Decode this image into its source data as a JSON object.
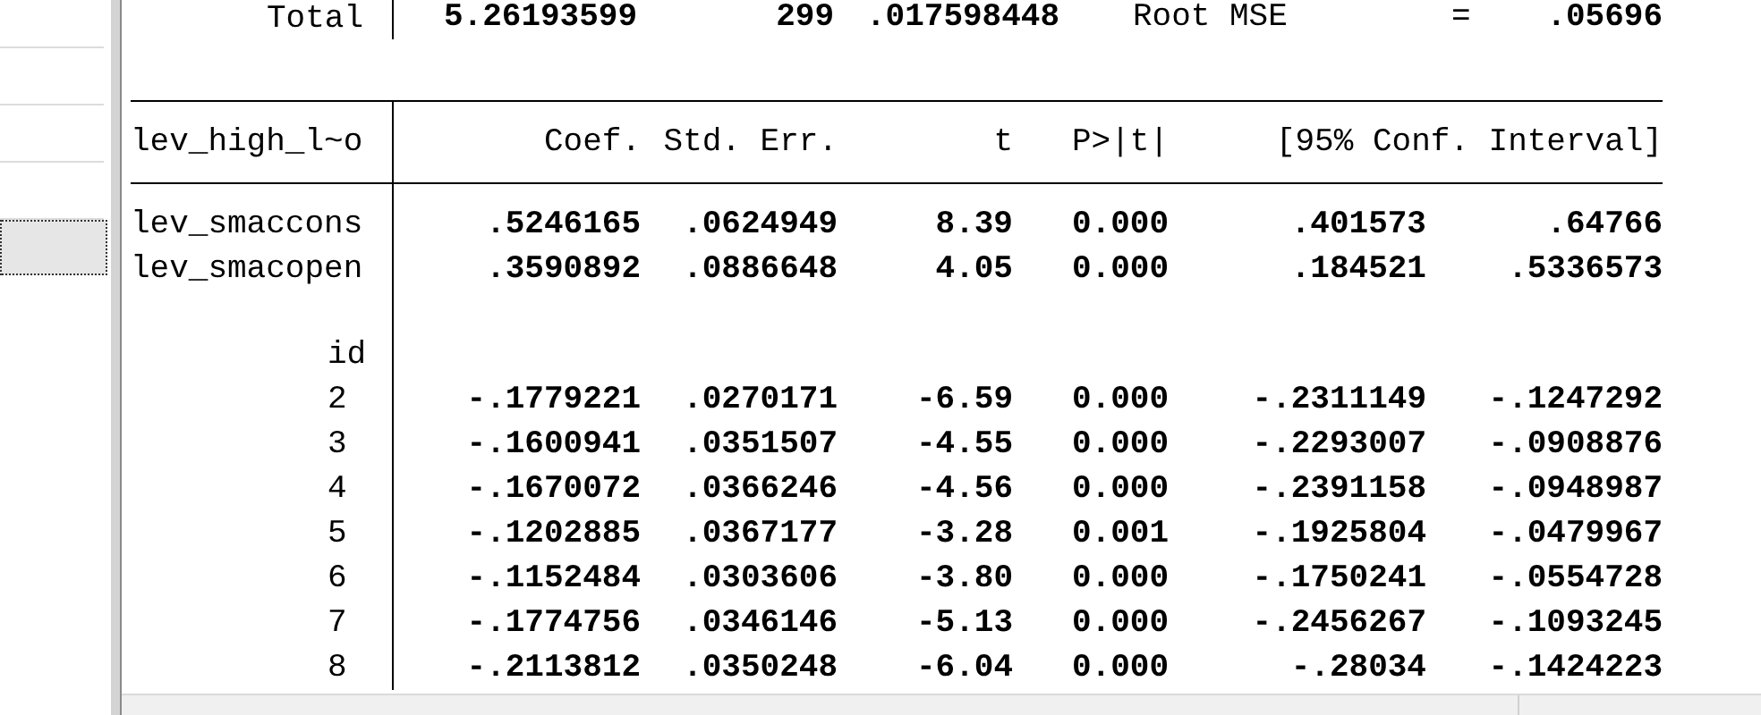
{
  "sidebar": {
    "items": [
      {
        "selected": false
      },
      {
        "selected": false
      },
      {
        "selected": false
      },
      {
        "selected": false
      },
      {
        "selected": true
      }
    ]
  },
  "anova_total": {
    "label": "Total",
    "ss": "5.26193599",
    "df": "299",
    "ms": ".017598448",
    "stat_label": "Root MSE",
    "equals": "=",
    "stat_value": ".05696"
  },
  "table": {
    "depvar": "lev_high_l~o",
    "columns": [
      "Coef.",
      "Std. Err.",
      "t",
      "P>|t|",
      "[95% Conf. Interval]"
    ],
    "rows": [
      {
        "kind": "var",
        "name": "lev_smaccons",
        "values": [
          ".5246165",
          ".0624949",
          "8.39",
          "0.000",
          ".401573",
          ".64766"
        ]
      },
      {
        "kind": "var",
        "name": "lev_smacopen",
        "values": [
          ".3590892",
          ".0886648",
          "4.05",
          "0.000",
          ".184521",
          ".5336573"
        ]
      },
      {
        "kind": "group",
        "name": "id"
      },
      {
        "kind": "level",
        "name": "2",
        "values": [
          "-.1779221",
          ".0270171",
          "-6.59",
          "0.000",
          "-.2311149",
          "-.1247292"
        ]
      },
      {
        "kind": "level",
        "name": "3",
        "values": [
          "-.1600941",
          ".0351507",
          "-4.55",
          "0.000",
          "-.2293007",
          "-.0908876"
        ]
      },
      {
        "kind": "level",
        "name": "4",
        "values": [
          "-.1670072",
          ".0366246",
          "-4.56",
          "0.000",
          "-.2391158",
          "-.0948987"
        ]
      },
      {
        "kind": "level",
        "name": "5",
        "values": [
          "-.1202885",
          ".0367177",
          "-3.28",
          "0.001",
          "-.1925804",
          "-.0479967"
        ]
      },
      {
        "kind": "level",
        "name": "6",
        "values": [
          "-.1152484",
          ".0303606",
          "-3.80",
          "0.000",
          "-.1750241",
          "-.0554728"
        ]
      },
      {
        "kind": "level",
        "name": "7",
        "values": [
          "-.1774756",
          ".0346146",
          "-5.13",
          "0.000",
          "-.2456267",
          "-.1093245"
        ]
      },
      {
        "kind": "level",
        "name": "8",
        "values": [
          "-.2113812",
          ".0350248",
          "-6.04",
          "0.000",
          "-.28034",
          "-.1424223"
        ]
      }
    ]
  }
}
